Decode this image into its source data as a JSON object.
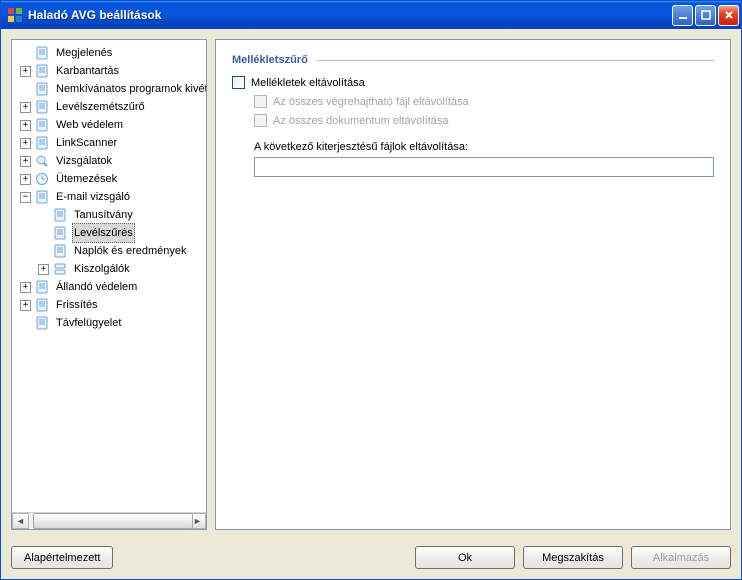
{
  "window": {
    "title": "Haladó AVG beállítások"
  },
  "tree": {
    "items": [
      {
        "label": "Megjelenés"
      },
      {
        "label": "Karbantartás"
      },
      {
        "label": "Nemkívánatos programok kivételei"
      },
      {
        "label": "Levélszemétszűrő"
      },
      {
        "label": "Web védelem"
      },
      {
        "label": "LinkScanner"
      },
      {
        "label": "Vizsgálatok"
      },
      {
        "label": "Ütemezések"
      },
      {
        "label": "E-mail vizsgáló"
      },
      {
        "label": "Tanusítvány"
      },
      {
        "label": "Levélszűrés"
      },
      {
        "label": "Naplók és eredmények"
      },
      {
        "label": "Kiszolgálók"
      },
      {
        "label": "Állandó védelem"
      },
      {
        "label": "Frissítés"
      },
      {
        "label": "Távfelügyelet"
      }
    ]
  },
  "main": {
    "group_title": "Mellékletszűrő",
    "chk_remove_attachments": "Mellékletek eltávolítása",
    "chk_remove_exe": "Az összes végrehajtható fájl eltávolítása",
    "chk_remove_doc": "Az összes dokumentum eltávolítása",
    "ext_label": "A következő kiterjesztésű fájlok eltávolítása:",
    "ext_value": ""
  },
  "buttons": {
    "default": "Alapértelmezett",
    "ok": "Ok",
    "cancel": "Megszakítás",
    "apply": "Alkalmazás"
  },
  "colors": {
    "accent": "#3a5caa"
  }
}
